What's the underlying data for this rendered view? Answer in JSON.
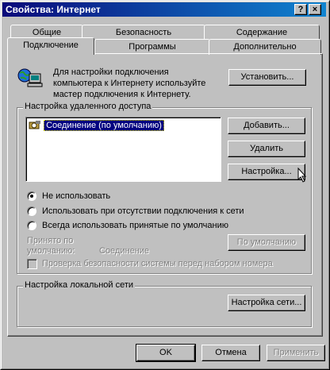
{
  "window": {
    "title": "Свойства: Интернет",
    "help_btn": "?",
    "close_btn": "×"
  },
  "tabs_back": [
    "Общие",
    "Безопасность",
    "Содержание"
  ],
  "tabs_front": [
    "Подключение",
    "Программы",
    "Дополнительно"
  ],
  "intro": {
    "line1": "Для настройки подключения",
    "line2": "компьютера к Интернету используйте",
    "line3": "мастер подключения к Интернету.",
    "setup_button": "Установить..."
  },
  "dialup": {
    "legend": "Настройка удаленного доступа",
    "items": [
      "Соединение (по умолчанию)"
    ],
    "add_button": "Добавить...",
    "remove_button": "Удалить",
    "settings_button": "Настройка...",
    "options": [
      "Не использовать",
      "Использовать при отсутствии подключения к сети",
      "Всегда использовать принятые по умолчанию"
    ],
    "selected_option": 0,
    "default_label_1": "Принято по",
    "default_label_2": "умолчанию:",
    "default_value": "Соединение",
    "set_default_button": "По умолчанию",
    "check_label": "Проверка безопасности системы перед набором номера"
  },
  "lan": {
    "legend": "Настройка локальной сети",
    "settings_button": "Настройка сети..."
  },
  "footer": {
    "ok": "OK",
    "cancel": "Отмена",
    "apply": "Применить"
  }
}
